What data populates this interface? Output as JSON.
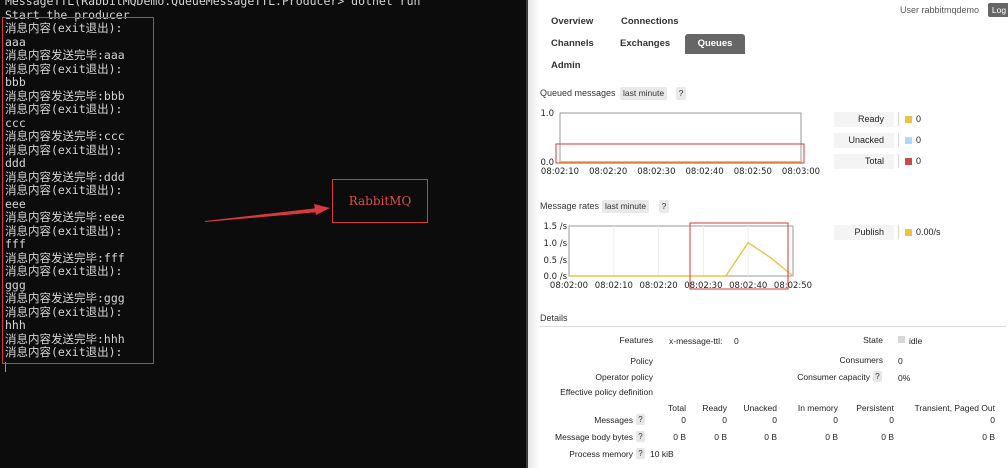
{
  "terminal": {
    "lines": [
      "MessageTTL(RabbitMQDemo.QueueMessageTTL.Producer> dotnet run",
      "Start the producer",
      "消息内容(exit退出):",
      "aaa",
      "消息内容发送完毕:aaa",
      "消息内容(exit退出):",
      "bbb",
      "消息内容发送完毕:bbb",
      "消息内容(exit退出):",
      "ccc",
      "消息内容发送完毕:ccc",
      "消息内容(exit退出):",
      "ddd",
      "消息内容发送完毕:ddd",
      "消息内容(exit退出):",
      "eee",
      "消息内容发送完毕:eee",
      "消息内容(exit退出):",
      "fff",
      "消息内容发送完毕:fff",
      "消息内容(exit退出):",
      "ggg",
      "消息内容发送完毕:ggg",
      "消息内容(exit退出):",
      "hhh",
      "消息内容发送完毕:hhh",
      "消息内容(exit退出):"
    ],
    "callout": "RabbitMQ"
  },
  "nav": {
    "overview": "Overview",
    "connections": "Connections",
    "channels": "Channels",
    "exchanges": "Exchanges",
    "queues": "Queues",
    "admin": "Admin",
    "user": "User rabbitmqdemo",
    "logout": "Log"
  },
  "queued": {
    "title": "Queued messages",
    "range": "last minute",
    "help": "?",
    "legend": [
      {
        "label": "Ready",
        "value": "0",
        "color": "#edc240"
      },
      {
        "label": "Unacked",
        "value": "0",
        "color": "#afd8f8"
      },
      {
        "label": "Total",
        "value": "0",
        "color": "#cb4b4b"
      }
    ]
  },
  "rates": {
    "title": "Message rates",
    "range": "last minute",
    "help": "?",
    "legend": [
      {
        "label": "Publish",
        "value": "0.00/s",
        "color": "#edc240"
      }
    ]
  },
  "chart_data": [
    {
      "type": "line",
      "y_ticks": [
        "1.0",
        "0.0"
      ],
      "x": [
        "08:02:10",
        "08:02:20",
        "08:02:30",
        "08:02:40",
        "08:02:50",
        "08:03:00"
      ],
      "ylim": [
        0,
        1
      ],
      "series": [
        {
          "name": "Ready",
          "color": "#edc240",
          "x": [
            "08:02:10",
            "08:03:00"
          ],
          "values": [
            0,
            0
          ]
        },
        {
          "name": "Unacked",
          "color": "#afd8f8",
          "x": [
            "08:02:10",
            "08:03:00"
          ],
          "values": [
            0,
            0
          ]
        },
        {
          "name": "Total",
          "color": "#cb4b4b",
          "x": [
            "08:02:10",
            "08:03:00"
          ],
          "values": [
            0,
            0
          ]
        }
      ]
    },
    {
      "type": "line",
      "y_ticks": [
        "1.5 /s",
        "1.0 /s",
        "0.5 /s",
        "0.0 /s"
      ],
      "x": [
        "08:02:00",
        "08:02:10",
        "08:02:20",
        "08:02:30",
        "08:02:40",
        "08:02:50"
      ],
      "ylim": [
        0,
        1.5
      ],
      "series": [
        {
          "name": "Publish",
          "color": "#edc240",
          "x": [
            "08:02:00",
            "08:02:10",
            "08:02:20",
            "08:02:30",
            "08:02:35",
            "08:02:40",
            "08:02:45",
            "08:02:50"
          ],
          "values": [
            0,
            0,
            0,
            0,
            0,
            1.0,
            0.55,
            0
          ]
        }
      ]
    }
  ],
  "details": {
    "title": "Details",
    "features_label": "Features",
    "features_value": "x-message-ttl:",
    "features_num": "0",
    "policy_label": "Policy",
    "operator_policy_label": "Operator policy",
    "effective_policy_label": "Effective policy definition",
    "state_label": "State",
    "state_value": "idle",
    "consumers_label": "Consumers",
    "consumers_value": "0",
    "capacity_label": "Consumer capacity",
    "capacity_value": "0%",
    "help": "?",
    "table": {
      "headers": [
        "Total",
        "Ready",
        "Unacked",
        "In memory",
        "Persistent",
        "Transient, Paged Out"
      ],
      "rows": [
        {
          "label": "Messages",
          "values": [
            "0",
            "0",
            "0",
            "0",
            "0",
            "0"
          ]
        },
        {
          "label": "Message body bytes",
          "values": [
            "0 B",
            "0 B",
            "0 B",
            "0 B",
            "0 B",
            "0 B"
          ]
        },
        {
          "label": "Process memory",
          "values": [
            "10 kiB"
          ]
        }
      ]
    }
  }
}
